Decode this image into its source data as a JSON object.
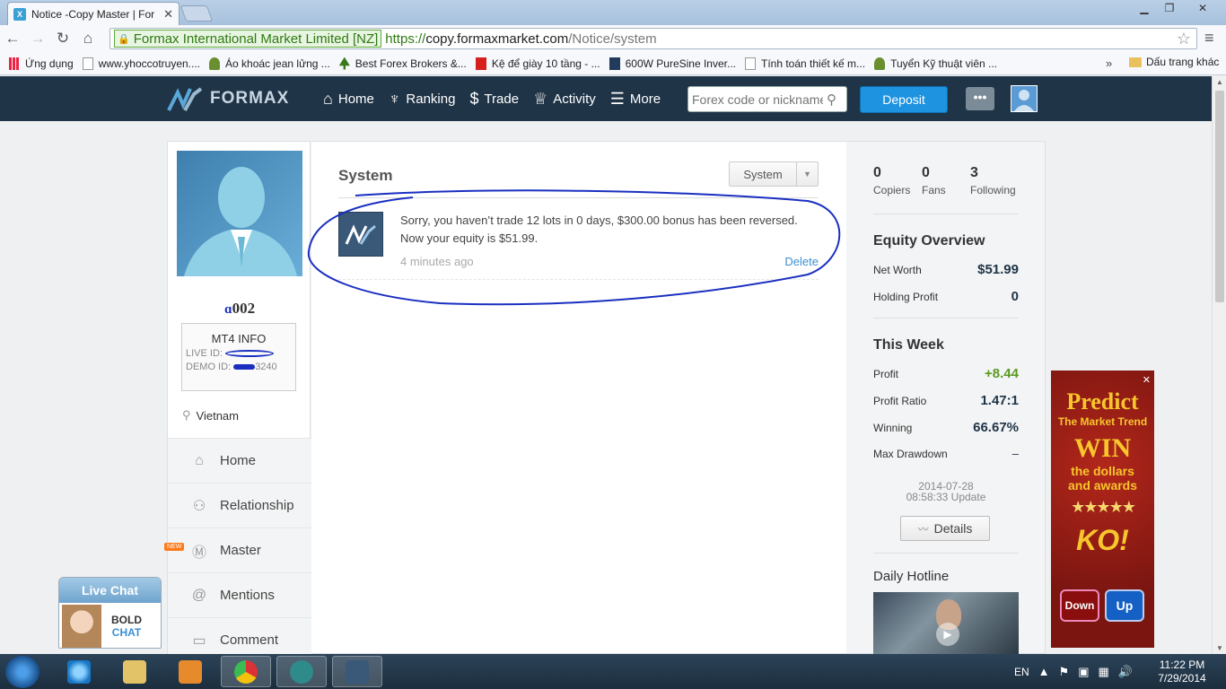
{
  "browser": {
    "tab_title": "Notice -Copy Master | For",
    "ev_label": "Formax International Market Limited [NZ]",
    "url_proto": "https://",
    "url_host": "copy.formaxmarket.com",
    "url_path": "/Notice/system",
    "bookmarks": [
      {
        "label": "Ứng dụng",
        "icon": "apps-icon"
      },
      {
        "label": "www.yhoccotruyen....",
        "icon": "page-icon"
      },
      {
        "label": "Áo khoác jean lửng ...",
        "icon": "person-icon"
      },
      {
        "label": "Best Forex Brokers &...",
        "icon": "tree-icon"
      },
      {
        "label": "Kệ để giày 10 tầng - ...",
        "icon": "red-square-icon"
      },
      {
        "label": "600W PureSine Inver...",
        "icon": "dark-square-icon"
      },
      {
        "label": "Tính toán thiết kế m...",
        "icon": "page-icon"
      },
      {
        "label": "Tuyển Kỹ thuật viên ...",
        "icon": "person-icon"
      }
    ],
    "bookmarks_more": "»",
    "other_bookmarks": "Dấu trang khác"
  },
  "header": {
    "logo_text": "FORMAX",
    "nav": [
      {
        "label": "Home",
        "icon": "home-icon"
      },
      {
        "label": "Ranking",
        "icon": "ranking-icon"
      },
      {
        "label": "Trade",
        "icon": "dollar-icon"
      },
      {
        "label": "Activity",
        "icon": "trophy-icon"
      },
      {
        "label": "More",
        "icon": "list-icon"
      }
    ],
    "search_placeholder": "Forex code or nickname",
    "deposit_label": "Deposit",
    "chat_glyph": "•••"
  },
  "profile": {
    "username": "002",
    "mt4_title": "MT4 INFO",
    "live_id_label": "LIVE ID:",
    "demo_id_label": "DEMO ID:",
    "demo_id_value": "3240",
    "location": "Vietnam",
    "menu": [
      {
        "label": "Home",
        "icon": "home-icon"
      },
      {
        "label": "Relationship",
        "icon": "people-icon"
      },
      {
        "label": "Master",
        "icon": "master-icon"
      },
      {
        "label": "Mentions",
        "icon": "at-icon"
      },
      {
        "label": "Comment",
        "icon": "comment-icon"
      }
    ],
    "new_badge": "NEW"
  },
  "main": {
    "title": "System",
    "select_value": "System",
    "notice": {
      "text": "Sorry, you haven’t trade 12 lots in 0 days, $300.00 bonus has been reversed. Now your equity is $51.99.",
      "time": "4 minutes ago",
      "delete_label": "Delete"
    }
  },
  "sidebar_right": {
    "stats": [
      {
        "num": "0",
        "label": "Copiers"
      },
      {
        "num": "0",
        "label": "Fans"
      },
      {
        "num": "3",
        "label": "Following"
      }
    ],
    "equity_title": "Equity Overview",
    "net_worth_label": "Net Worth",
    "net_worth_value": "$51.99",
    "holding_label": "Holding Profit",
    "holding_value": "0",
    "week_title": "This Week",
    "profit_label": "Profit",
    "profit_value": "+8.44",
    "ratio_label": "Profit Ratio",
    "ratio_value": "1.47:1",
    "winning_label": "Winning",
    "winning_value": "66.67%",
    "drawdown_label": "Max Drawdown",
    "drawdown_value": "–",
    "update_date": "2014-07-28",
    "update_time": "08:58:33 Update",
    "details_label": "Details",
    "hotline_title": "Daily Hotline"
  },
  "ad": {
    "line1": "Predict",
    "line2": "The Market Trend",
    "line3": "WIN",
    "line4a": "the dollars",
    "line4b": "and awards",
    "line5": "KO!",
    "down_label": "Down",
    "up_label": "Up"
  },
  "livechat": {
    "title": "Live Chat",
    "brand_top": "BOLD",
    "brand_bottom": "CHAT"
  },
  "taskbar": {
    "lang": "EN",
    "time": "11:22 PM",
    "date": "7/29/2014"
  },
  "colors": {
    "header_bg": "#1f3447",
    "deposit": "#1e93e0",
    "accent_link": "#3d8fd0",
    "profit_green": "#5a9a22"
  }
}
